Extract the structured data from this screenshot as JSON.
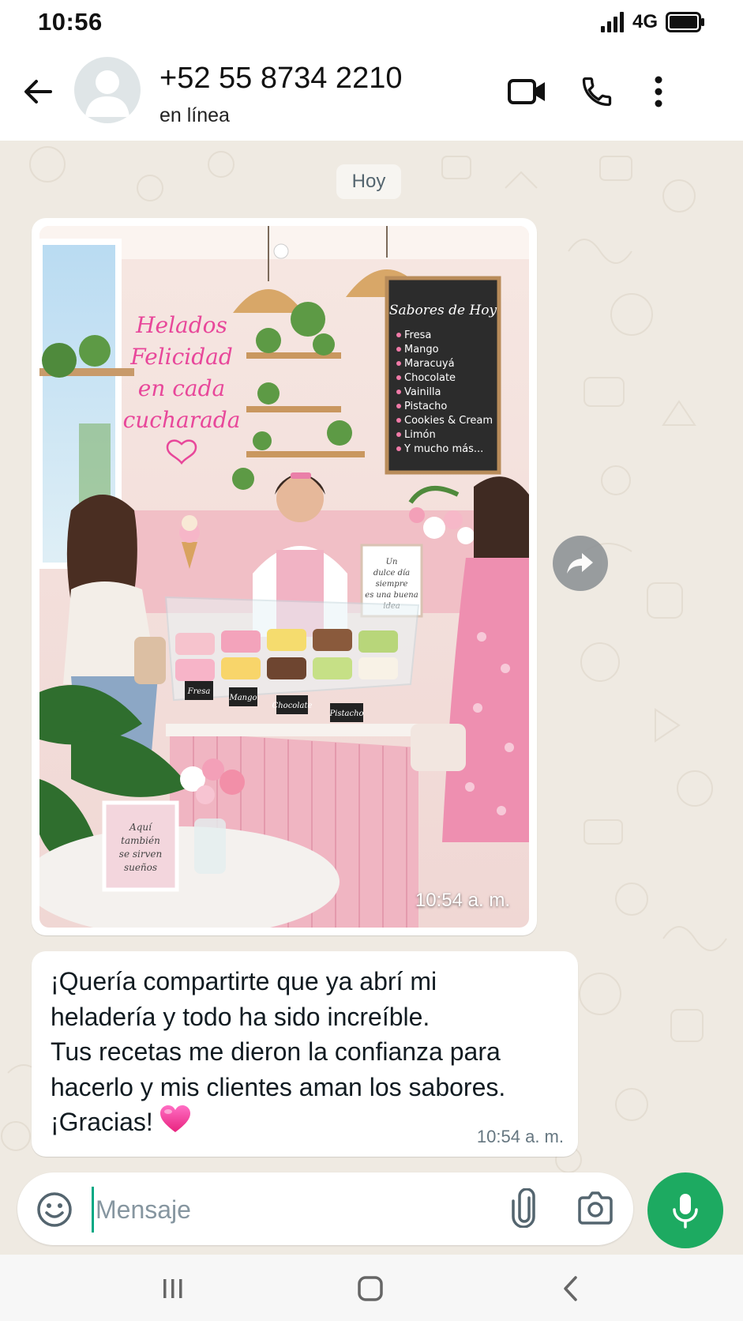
{
  "status_bar": {
    "time": "10:56",
    "network": "4G"
  },
  "header": {
    "contact_name": "+52 55 8734 2210",
    "contact_status": "en línea"
  },
  "chat": {
    "date_chip": "Hoy",
    "image_message": {
      "time": "10:54 a. m.",
      "photo_texts": {
        "neon_sign": [
          "Helados",
          "Felicidad",
          "en cada",
          "cucharada"
        ],
        "board_title": "Sabores de Hoy",
        "board_items": [
          "Fresa",
          "Mango",
          "Maracuyá",
          "Chocolate",
          "Vainilla",
          "Pistacho",
          "Cookies & Cream",
          "Limón",
          "Y mucho más..."
        ],
        "counter_card": [
          "Un",
          "dulce día",
          "siempre",
          "es una buena",
          "idea"
        ],
        "flavor_tags": [
          "Fresa",
          "Mango",
          "Chocolate",
          "Pistacho"
        ],
        "table_card": [
          "Aquí",
          "también",
          "se sirven",
          "sueños"
        ]
      }
    },
    "text_message": {
      "text": "¡Quería compartirte que ya abrí mi\nheladería y todo ha sido increíble.\nTus recetas me dieron la confianza para\nhacerlo y mis clientes aman los sabores.\n¡Gracias!",
      "emoji": "pink-heart",
      "time": "10:54 a. m."
    }
  },
  "composer": {
    "placeholder": "Mensaje"
  },
  "colors": {
    "accent_green": "#1daa61",
    "chat_background": "#efeae2",
    "bubble": "#ffffff",
    "timestamp": "#667781"
  },
  "icons": {
    "back": "arrow-left-icon",
    "video": "video-camera-icon",
    "call": "phone-icon",
    "menu": "more-vertical-icon",
    "forward": "forward-icon",
    "emoji": "smiley-icon",
    "attach": "paperclip-icon",
    "camera": "camera-icon",
    "mic": "microphone-icon"
  }
}
